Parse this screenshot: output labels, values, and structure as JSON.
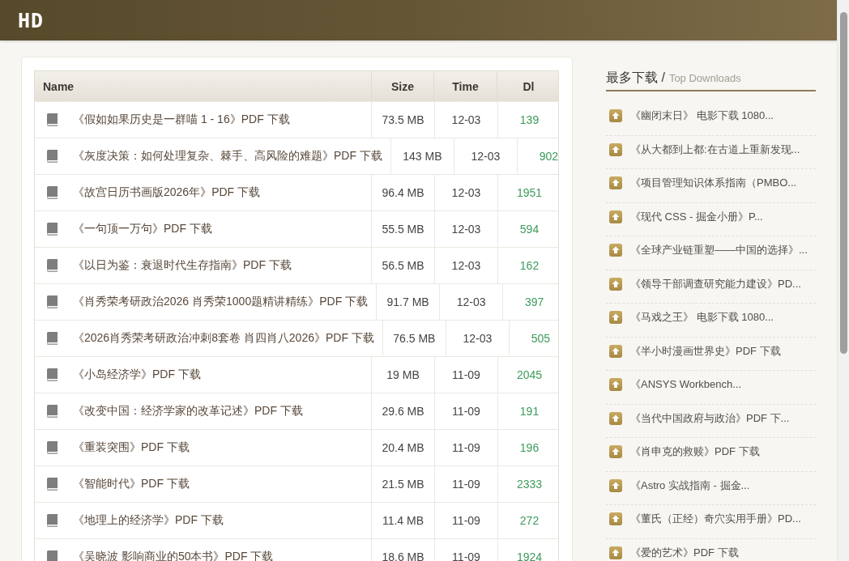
{
  "header": {
    "logo": "HD"
  },
  "table": {
    "columns": [
      "Name",
      "Size",
      "Time",
      "Dl"
    ],
    "rows": [
      {
        "name": "《假如如果历史是一群喵 1 - 16》PDF 下载",
        "size": "73.5 MB",
        "time": "12-03",
        "downloads": "139"
      },
      {
        "name": "《灰度决策：如何处理复杂、棘手、高风险的难题》PDF 下载",
        "size": "143 MB",
        "time": "12-03",
        "downloads": "902"
      },
      {
        "name": "《故宫日历书画版2026年》PDF 下载",
        "size": "96.4 MB",
        "time": "12-03",
        "downloads": "1951"
      },
      {
        "name": "《一句顶一万句》PDF 下载",
        "size": "55.5 MB",
        "time": "12-03",
        "downloads": "594"
      },
      {
        "name": "《以日为鉴：衰退时代生存指南》PDF 下载",
        "size": "56.5 MB",
        "time": "12-03",
        "downloads": "162"
      },
      {
        "name": "《肖秀荣考研政治2026 肖秀荣1000题精讲精练》PDF 下载",
        "size": "91.7 MB",
        "time": "12-03",
        "downloads": "397"
      },
      {
        "name": "《2026肖秀荣考研政治冲刺8套卷 肖四肖八2026》PDF 下载",
        "size": "76.5 MB",
        "time": "12-03",
        "downloads": "505"
      },
      {
        "name": "《小岛经济学》PDF 下载",
        "size": "19 MB",
        "time": "11-09",
        "downloads": "2045"
      },
      {
        "name": "《改变中国：经济学家的改革记述》PDF 下载",
        "size": "29.6 MB",
        "time": "11-09",
        "downloads": "191"
      },
      {
        "name": "《重装突围》PDF 下载",
        "size": "20.4 MB",
        "time": "11-09",
        "downloads": "196"
      },
      {
        "name": "《智能时代》PDF 下载",
        "size": "21.5 MB",
        "time": "11-09",
        "downloads": "2333"
      },
      {
        "name": "《地理上的经济学》PDF 下载",
        "size": "11.4 MB",
        "time": "11-09",
        "downloads": "272"
      },
      {
        "name": "《吴晓波 影响商业的50本书》PDF 下载",
        "size": "18.6 MB",
        "time": "11-09",
        "downloads": "1924"
      }
    ]
  },
  "sidebar": {
    "title": "最多下载 /",
    "subtitle": "Top Downloads",
    "items": [
      "《幽闭末日》 电影下载 1080...",
      "《从大都到上都:在古道上重新发现...",
      "《项目管理知识体系指南（PMBO...",
      "《现代 CSS - 掘金小册》P...",
      "《全球产业链重塑——中国的选择》...",
      "《领导干部调查研究能力建设》PD...",
      "《马戏之王》 电影下载 1080...",
      "《半小时漫画世界史》PDF 下载",
      "《ANSYS Workbench...",
      "《当代中国政府与政治》PDF 下...",
      "《肖申克的救赎》PDF 下载",
      "《Astro 实战指南 - 掘金...",
      "《董氏（正经）奇穴实用手册》PD...",
      "《爱的艺术》PDF 下载"
    ]
  }
}
